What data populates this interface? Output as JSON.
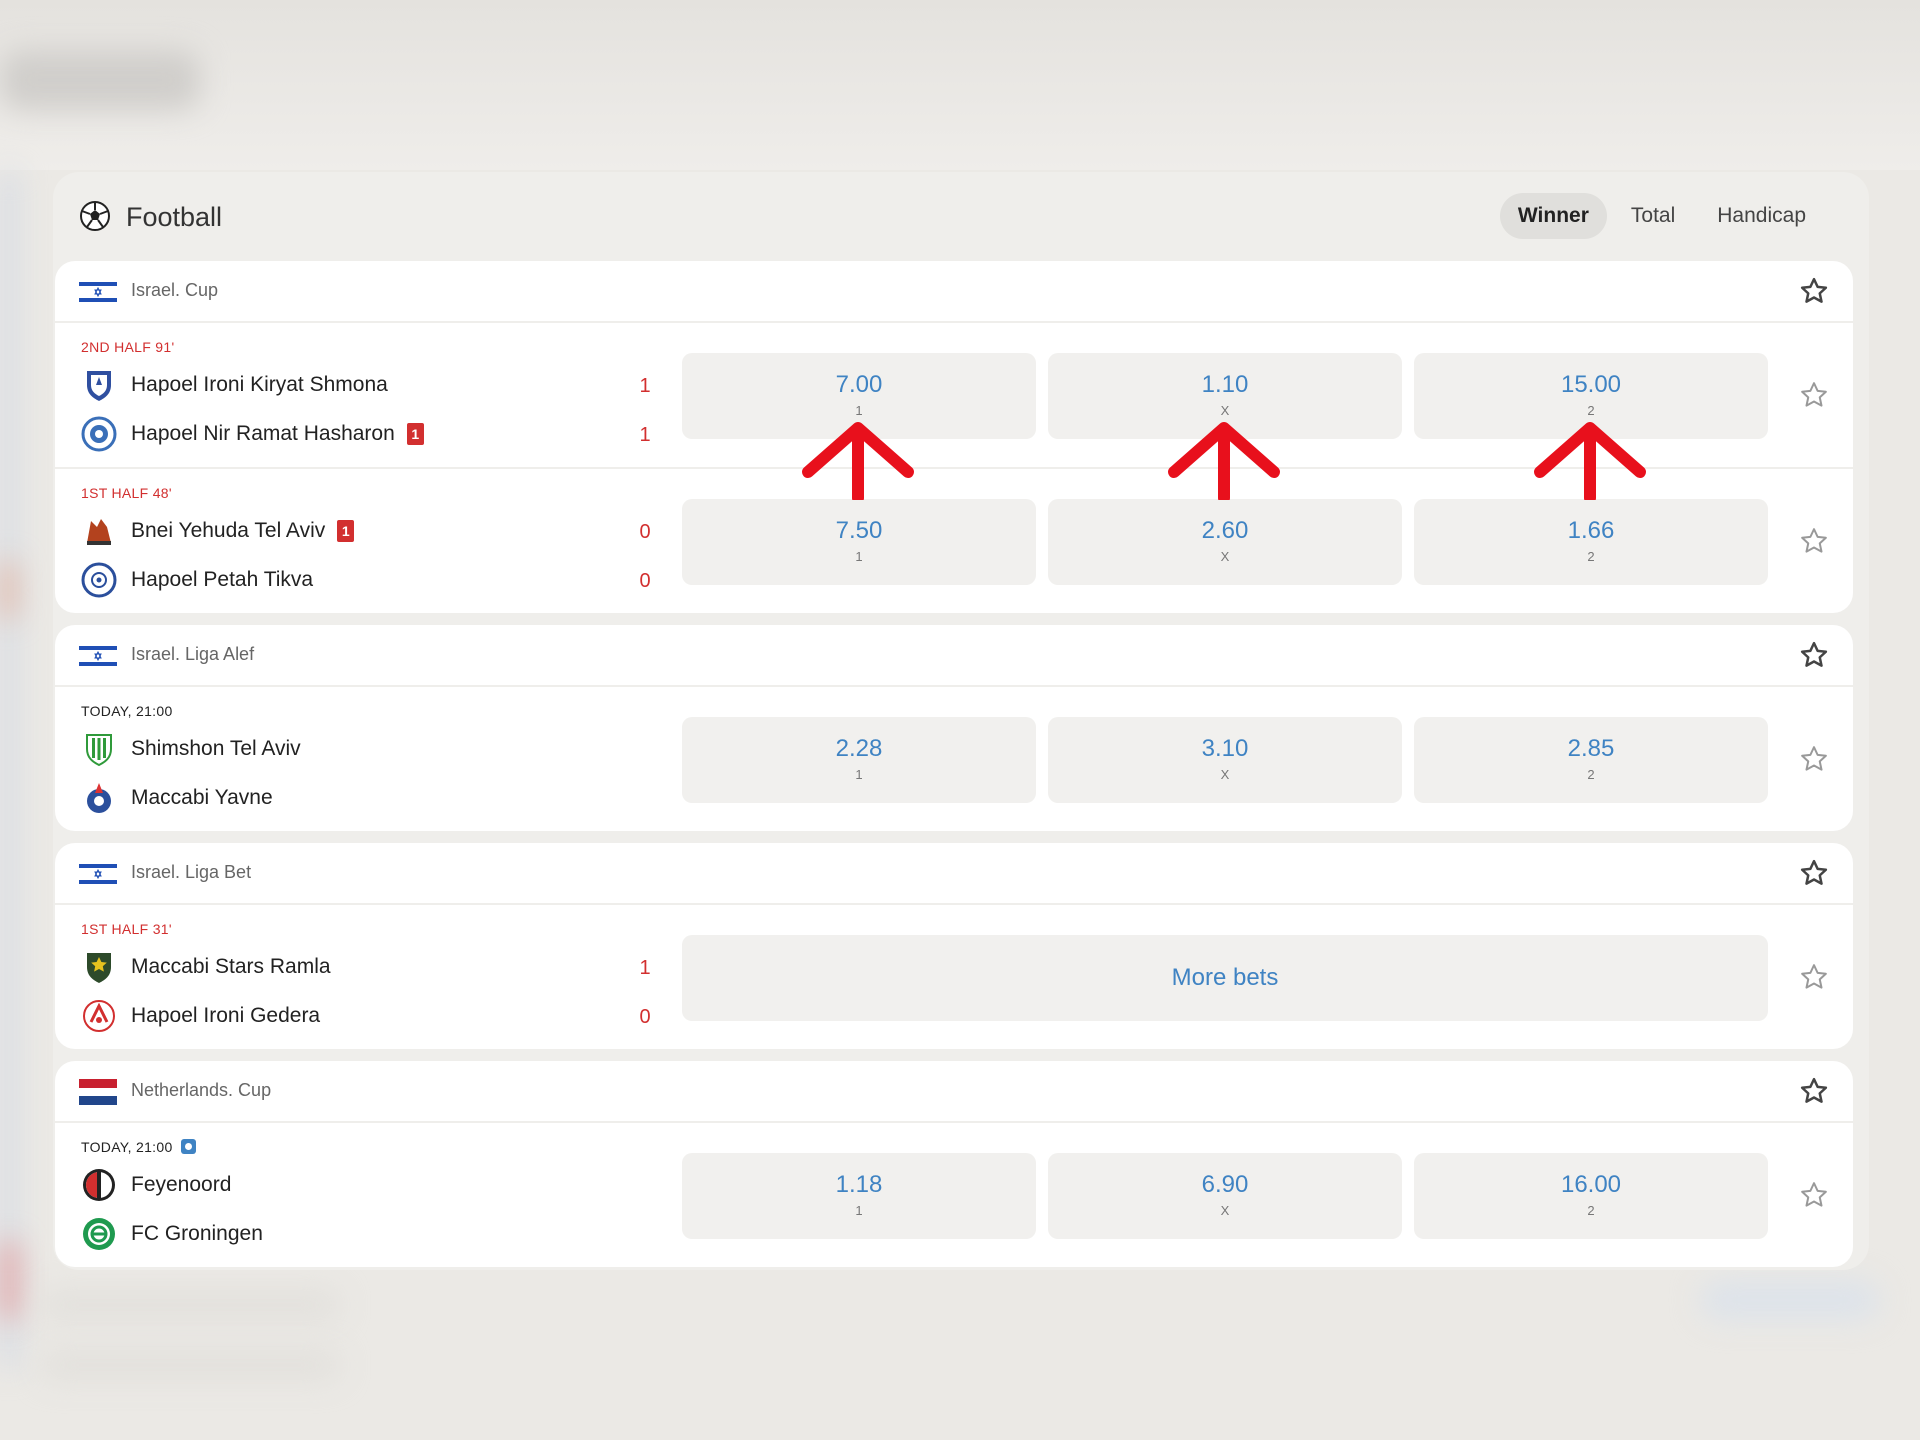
{
  "sport": {
    "title": "Football",
    "icon": "soccer-ball-icon"
  },
  "tabs": [
    {
      "label": "Winner",
      "active": true
    },
    {
      "label": "Total",
      "active": false
    },
    {
      "label": "Handicap",
      "active": false
    }
  ],
  "colors": {
    "odds": "#3f83c3",
    "live": "#d22f2f",
    "annotation_arrow": "#e8101c"
  },
  "leagues": [
    {
      "name": "Israel. Cup",
      "flag": "israel-flag",
      "events": [
        {
          "status": "2ND HALF 91'",
          "live": true,
          "team1": "Hapoel Ironi Kiryat Shmona",
          "team2": "Hapoel Nir Ramat Hasharon",
          "team2_red_cards": "1",
          "score1": "1",
          "score2": "1",
          "odds": [
            {
              "value": "7.00",
              "label": "1"
            },
            {
              "value": "1.10",
              "label": "X"
            },
            {
              "value": "15.00",
              "label": "2"
            }
          ]
        },
        {
          "status": "1ST HALF 48'",
          "live": true,
          "team1": "Bnei Yehuda Tel Aviv",
          "team2": "Hapoel Petah Tikva",
          "team1_red_cards": "1",
          "score1": "0",
          "score2": "0",
          "odds": [
            {
              "value": "7.50",
              "label": "1"
            },
            {
              "value": "2.60",
              "label": "X"
            },
            {
              "value": "1.66",
              "label": "2"
            }
          ]
        }
      ]
    },
    {
      "name": "Israel. Liga Alef",
      "flag": "israel-flag",
      "events": [
        {
          "status": "TODAY, 21:00",
          "live": false,
          "team1": "Shimshon Tel Aviv",
          "team2": "Maccabi Yavne",
          "odds": [
            {
              "value": "2.28",
              "label": "1"
            },
            {
              "value": "3.10",
              "label": "X"
            },
            {
              "value": "2.85",
              "label": "2"
            }
          ]
        }
      ]
    },
    {
      "name": "Israel. Liga Bet",
      "flag": "israel-flag",
      "events": [
        {
          "status": "1ST HALF 31'",
          "live": true,
          "team1": "Maccabi Stars Ramla",
          "team2": "Hapoel Ironi Gedera",
          "score1": "1",
          "score2": "0",
          "more_bets": "More bets"
        }
      ]
    },
    {
      "name": "Netherlands. Cup",
      "flag": "netherlands-flag",
      "events": [
        {
          "status": "TODAY, 21:00",
          "live": false,
          "team1": "Feyenoord",
          "team2": "FC Groningen",
          "odds": [
            {
              "value": "1.18",
              "label": "1"
            },
            {
              "value": "6.90",
              "label": "X"
            },
            {
              "value": "16.00",
              "label": "2"
            }
          ]
        }
      ]
    }
  ]
}
